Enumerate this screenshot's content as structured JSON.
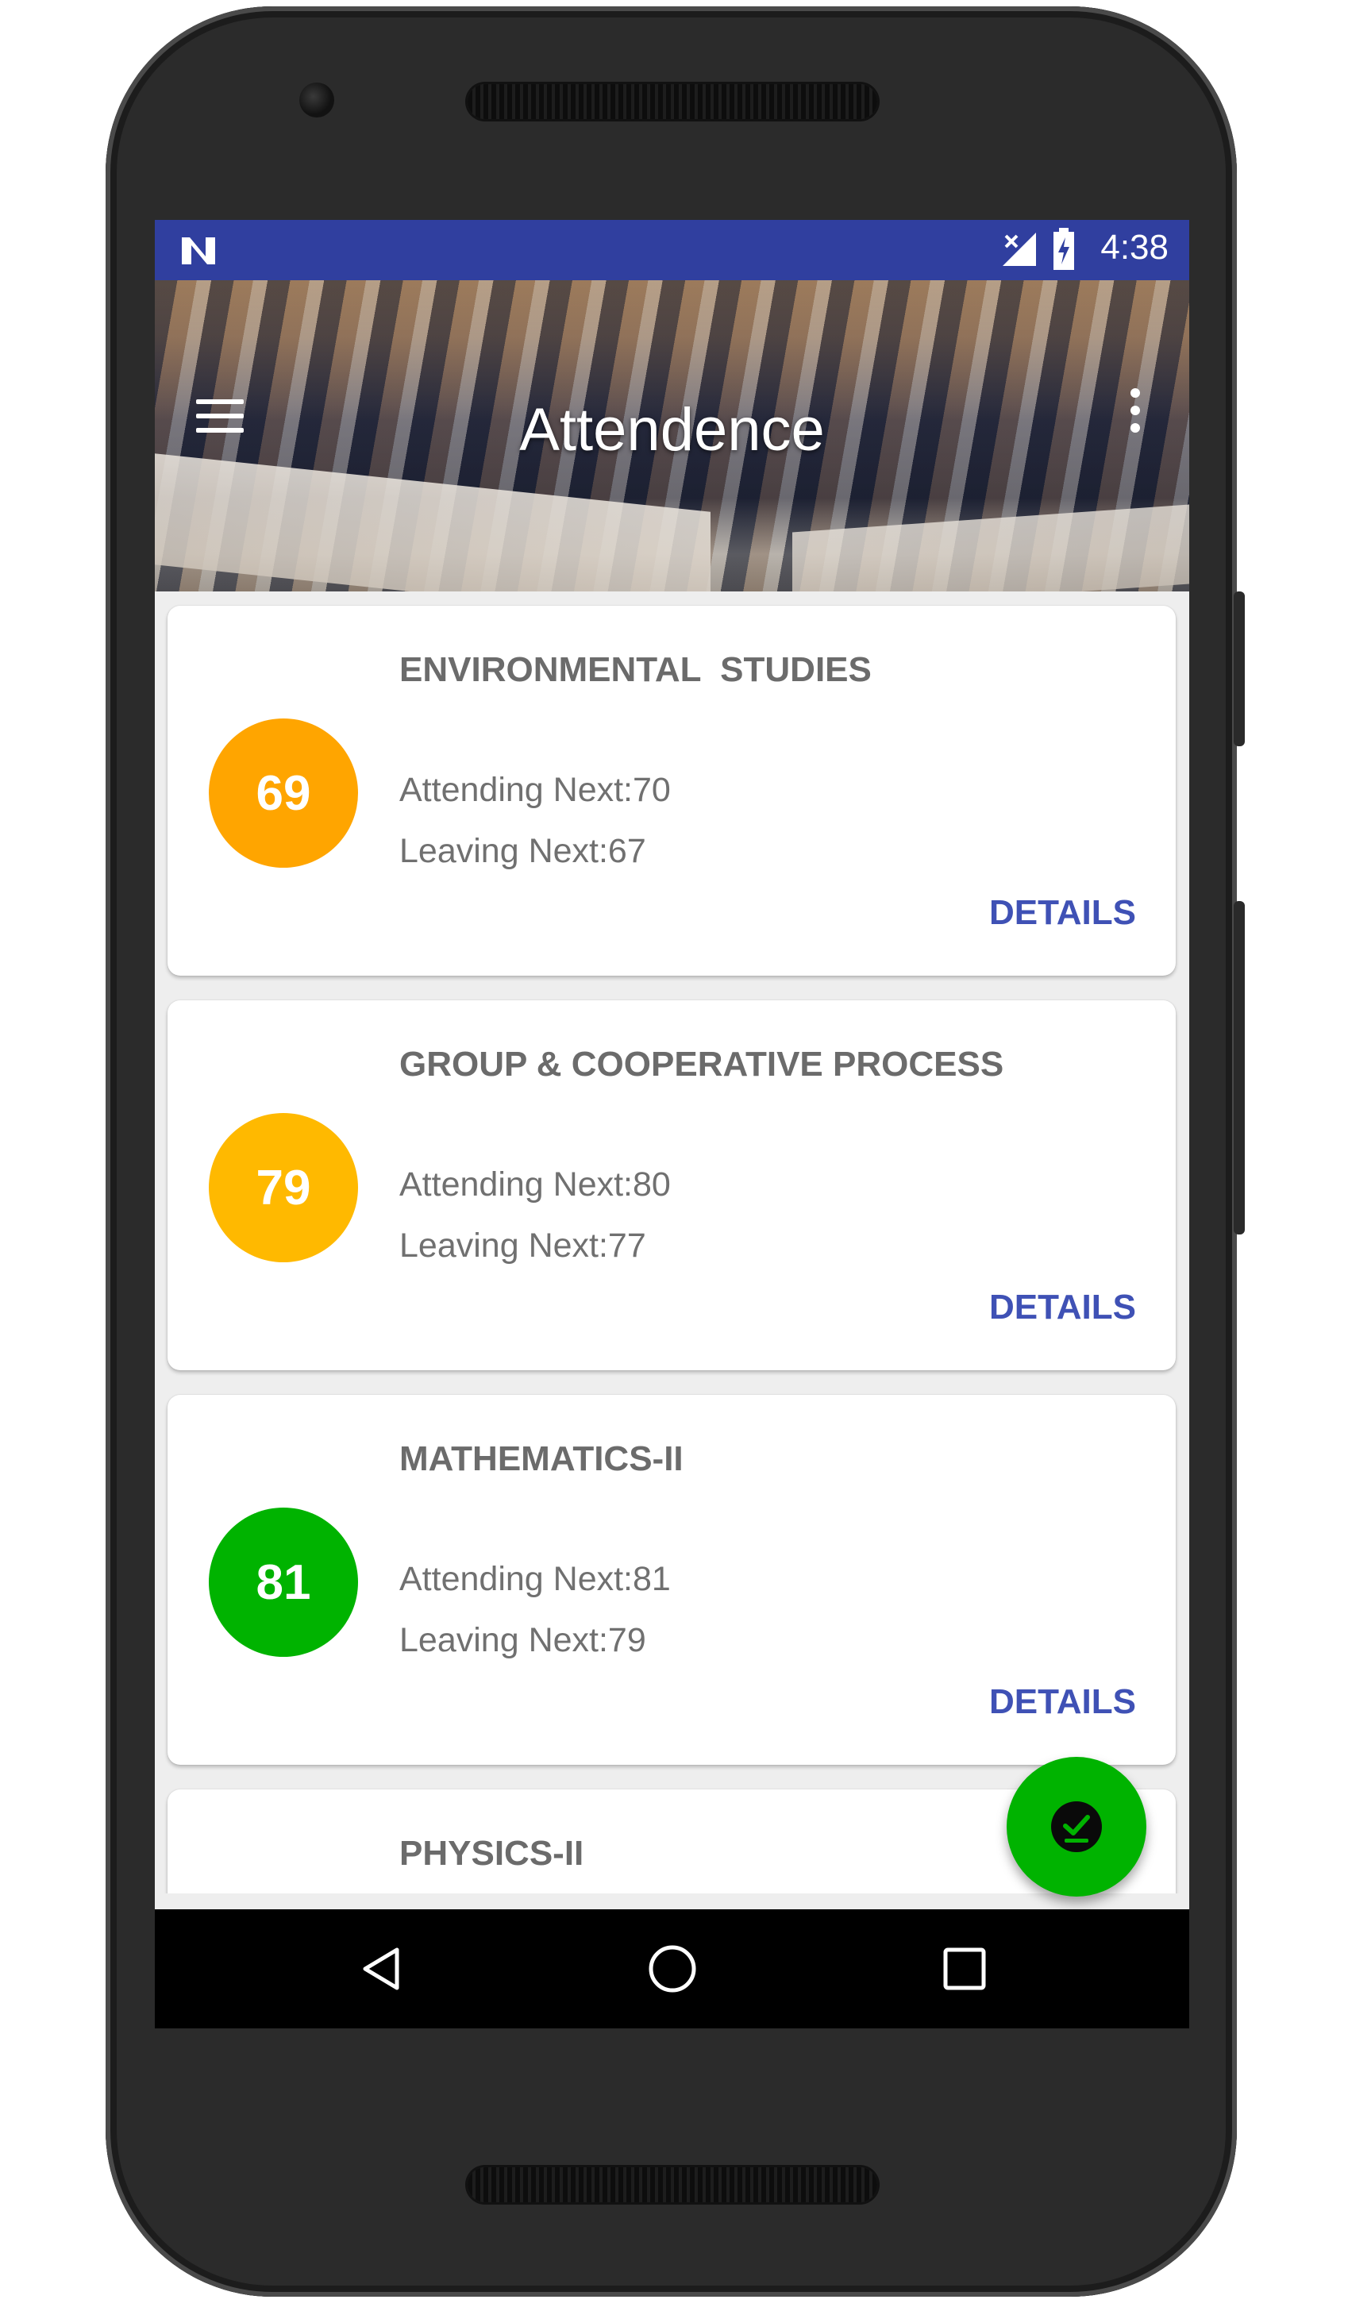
{
  "status_bar": {
    "time": "4:38",
    "background": "#303f9f"
  },
  "app_bar": {
    "title": "Attendence"
  },
  "courses": [
    {
      "title": "ENVIRONMENTAL  STUDIES",
      "percent": "69",
      "color": "#ffa500",
      "attending_next": "Attending Next:70",
      "leaving_next": "Leaving Next:67",
      "action_label": "DETAILS"
    },
    {
      "title": "GROUP & COOPERATIVE PROCESS",
      "percent": "79",
      "color": "#ffb900",
      "attending_next": "Attending Next:80",
      "leaving_next": "Leaving Next:77",
      "action_label": "DETAILS"
    },
    {
      "title": "MATHEMATICS-II",
      "percent": "81",
      "color": "#00b300",
      "attending_next": "Attending Next:81",
      "leaving_next": "Leaving Next:79",
      "action_label": "DETAILS"
    },
    {
      "title": "PHYSICS-II",
      "percent": "",
      "color": "#ffb900",
      "attending_next": "",
      "leaving_next": "",
      "action_label": ""
    }
  ],
  "fab": {
    "icon": "check-circle-icon",
    "color": "#00b300"
  },
  "colors": {
    "accent": "#3f51b5",
    "card_title": "#6b6b6b"
  }
}
